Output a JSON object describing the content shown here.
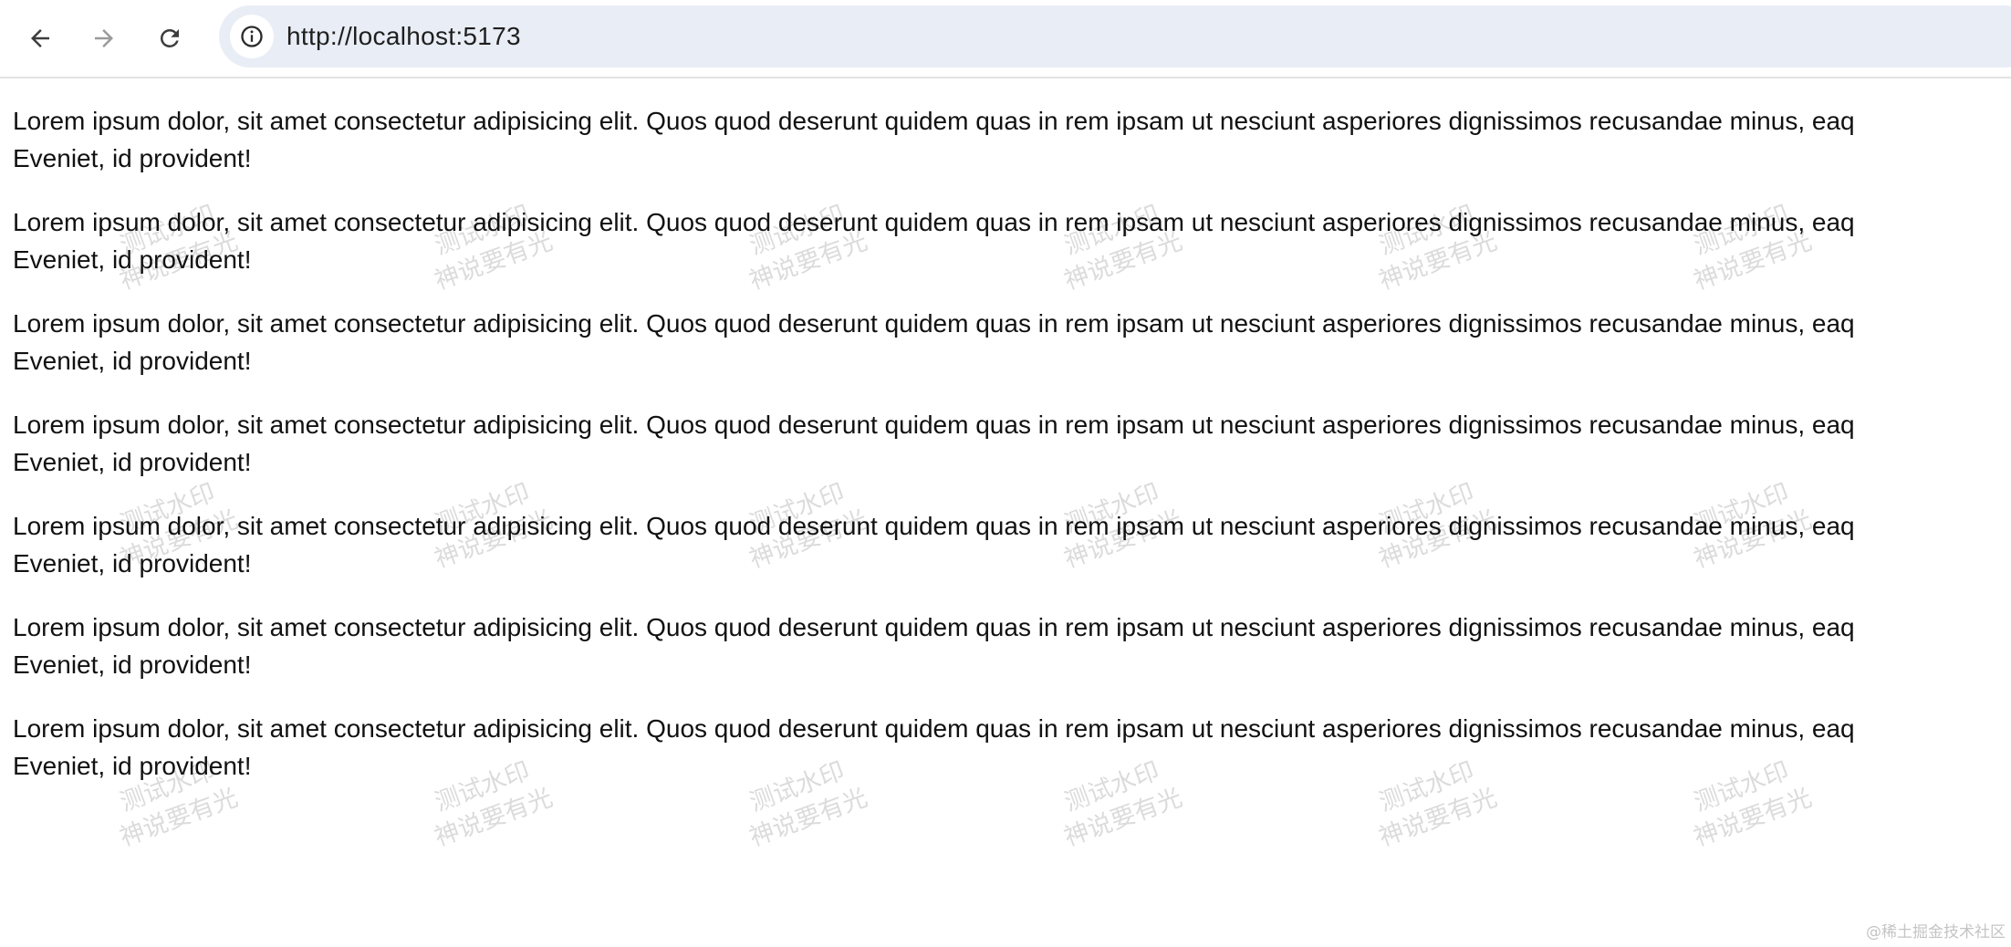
{
  "browser": {
    "url": "http://localhost:5173"
  },
  "page": {
    "paragraph_line1": "Lorem ipsum dolor, sit amet consectetur adipisicing elit. Quos quod deserunt quidem quas in rem ipsam ut nesciunt asperiores dignissimos recusandae minus, eaq",
    "paragraph_line2": "Eveniet, id provident!"
  },
  "watermark": {
    "line1": "测试水印",
    "line2": "神说要有光"
  },
  "footer": {
    "credit": "@稀土掘金技术社区"
  }
}
